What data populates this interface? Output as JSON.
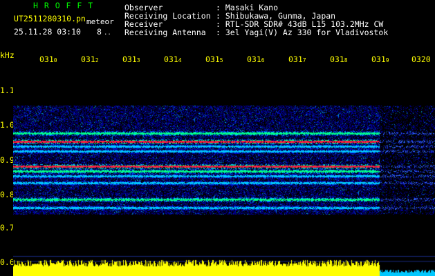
{
  "header": {
    "station": "H R O F F T",
    "filename": "UT2511280310.pn",
    "mode": "meteor",
    "datetime": "25.11.28 03:10",
    "extra": "8",
    "extra2": "..",
    "observer_label": "Observer",
    "observer_value": ": Masaki Kano",
    "location_label": "Receiving Location",
    "location_value": ": Shibukawa, Gunma, Japan",
    "receiver_label": "Receiver",
    "receiver_value": ": RTL-SDR SDR# 43dB L15 103.2MHz CW",
    "antenna_label": "Receiving Antenna",
    "antenna_value": ": 3el Yagi(V) Az 330 for Vladivostok"
  },
  "axis": {
    "y_unit": "kHz",
    "y_ticks": [
      "1.1",
      "1.0",
      "0.9",
      "0.8",
      "0.7",
      "0.6"
    ],
    "x_ticks": [
      "031",
      "031",
      "031",
      "031",
      "031",
      "031",
      "031",
      "031",
      "031",
      "0320"
    ],
    "x_tick_suffix": [
      "0",
      "2",
      "3",
      "4",
      "5",
      "6",
      "7",
      "8",
      "9",
      ""
    ]
  },
  "colors": {
    "background": "#000000",
    "label": "#ffff00",
    "text": "#ffffff",
    "station": "#00ff00",
    "noise": "#0000aa",
    "signal_low": "#00c8ff",
    "signal_mid": "#00ff88",
    "signal_high": "#ff2040",
    "power_bar": "#ffff00"
  },
  "chart_data": {
    "type": "heatmap",
    "title": "",
    "xlabel": "",
    "ylabel": "kHz",
    "x_range": [
      "0310",
      "0320"
    ],
    "ylim": [
      0.6,
      1.15
    ],
    "bands_khz": [
      {
        "freq": 0.99,
        "level": "mid"
      },
      {
        "freq": 0.965,
        "level": "high"
      },
      {
        "freq": 0.95,
        "level": "low"
      },
      {
        "freq": 0.935,
        "level": "low"
      },
      {
        "freq": 0.89,
        "level": "high"
      },
      {
        "freq": 0.875,
        "level": "mid"
      },
      {
        "freq": 0.86,
        "level": "low"
      },
      {
        "freq": 0.84,
        "level": "low"
      },
      {
        "freq": 0.79,
        "level": "mid"
      },
      {
        "freq": 0.765,
        "level": "low"
      }
    ],
    "signal_end_fraction": 0.87
  }
}
